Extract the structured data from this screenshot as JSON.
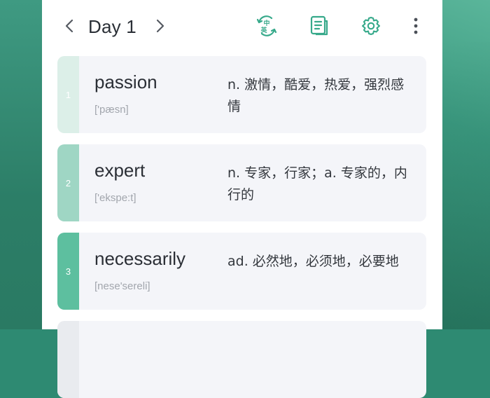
{
  "header": {
    "title": "Day 1",
    "lang_toggle": {
      "top": "中",
      "bottom": "英"
    }
  },
  "colors": {
    "accent": "#36a98a",
    "background": "#2e8a72",
    "card_bg": "#f4f5f9"
  },
  "icons": {
    "prev": "chevron-left-icon",
    "next": "chevron-right-icon",
    "lang": "language-switch-icon",
    "list": "word-list-icon",
    "settings": "gear-icon",
    "more": "more-vertical-icon"
  },
  "words": [
    {
      "index": "1",
      "word": "passion",
      "phonetic": "['pæsn]",
      "definition": "n. 激情，酷爱，热爱，强烈感情"
    },
    {
      "index": "2",
      "word": "expert",
      "phonetic": "['ekspe:t]",
      "definition": "n. 专家，行家；a. 专家的，内行的"
    },
    {
      "index": "3",
      "word": "necessarily",
      "phonetic": "[nese'sereli]",
      "definition": "ad. 必然地，必须地，必要地"
    }
  ]
}
